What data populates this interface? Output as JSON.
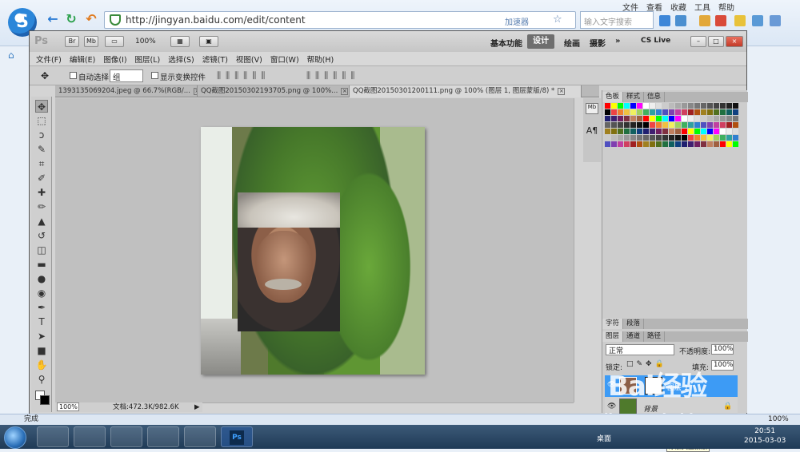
{
  "browser": {
    "url": "http://jingyan.baidu.com/edit/content",
    "accelerator": "加速器",
    "search_placeholder": "输入文字搜索",
    "menu": [
      "文件",
      "查看",
      "收藏",
      "工具",
      "帮助"
    ],
    "status": "完成",
    "zoom": "100%"
  },
  "ps": {
    "logo": "Ps",
    "title_buttons": [
      "Br",
      "Mb"
    ],
    "zoom_select": "100%",
    "workspaces": [
      "基本功能",
      "设计",
      "绘画",
      "摄影"
    ],
    "active_workspace": "设计",
    "cslive": "CS Live",
    "menus": [
      "文件(F)",
      "编辑(E)",
      "图像(I)",
      "图层(L)",
      "选择(S)",
      "滤镜(T)",
      "视图(V)",
      "窗口(W)",
      "帮助(H)"
    ],
    "options": {
      "auto_select": "自动选择:",
      "auto_select_value": "组",
      "show_transform": "显示变换控件"
    },
    "tabs": [
      {
        "label": "1393135069204.jpeg @ 66.7%(RGB/..."
      },
      {
        "label": "QQ截图20150302193705.png @ 100%..."
      },
      {
        "label": "QQ截图20150301200111.png @ 100% (图层 1, 图层蒙版/8) *"
      }
    ],
    "status": {
      "zoom": "100%",
      "doc": "文档:472.3K/982.6K"
    },
    "panels": {
      "swatch_tabs": [
        "色板",
        "样式",
        "信息"
      ],
      "char_tabs": [
        "字符",
        "段落"
      ],
      "layer_tabs": [
        "图层",
        "通道",
        "路径"
      ],
      "blend_mode": "正常",
      "opacity_label": "不透明度:",
      "opacity": "100%",
      "lock_label": "锁定:",
      "fill_label": "填充:",
      "fill": "100%",
      "layers": [
        {
          "name": "图层 1"
        },
        {
          "name": "背景"
        }
      ],
      "tooltip": "添加矢量蒙版"
    }
  },
  "watermark": {
    "brand": "Bai经验",
    "url": "jingyan.baidu.com"
  },
  "taskbar": {
    "desktop": "桌面",
    "time": "20:51",
    "date": "2015-03-03"
  }
}
